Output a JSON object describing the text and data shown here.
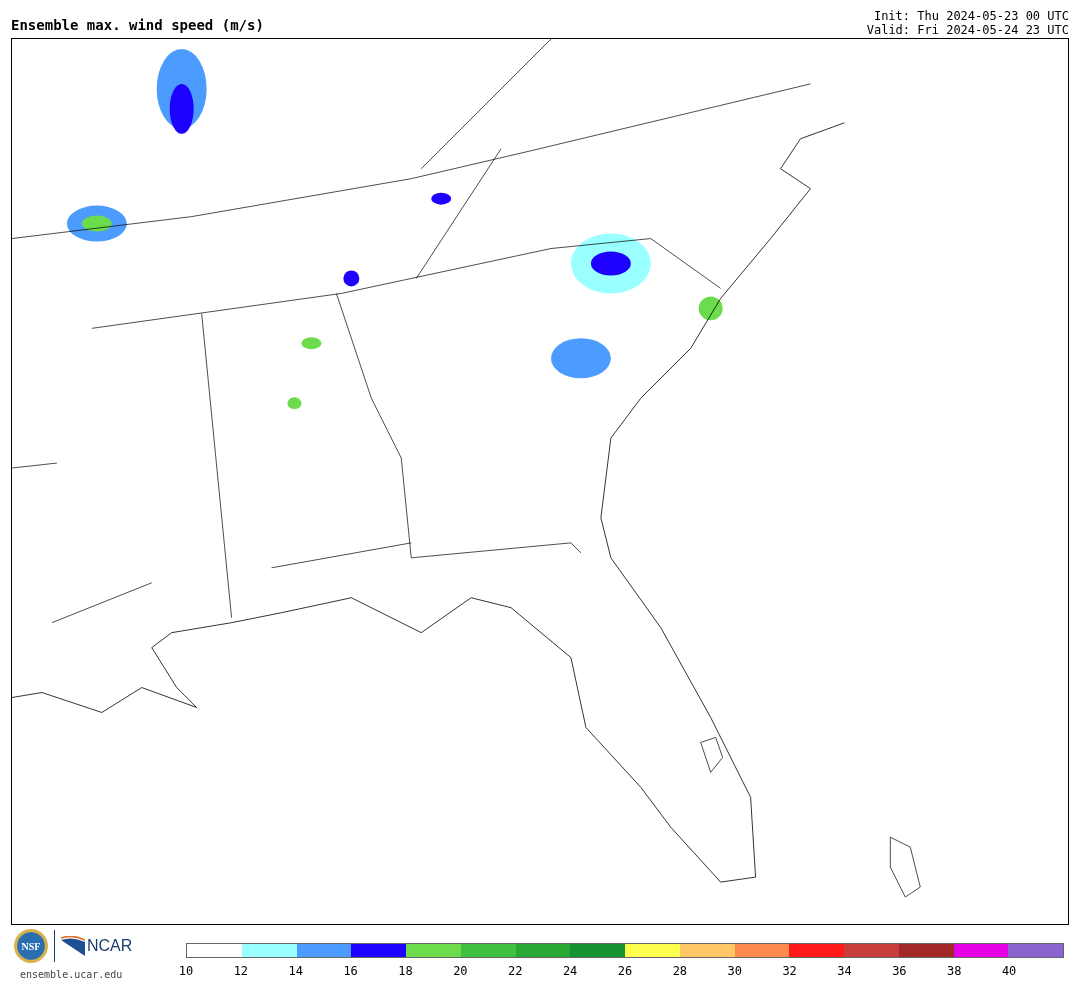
{
  "title": "Ensemble max. wind speed (m/s)",
  "init": "Init: Thu 2024-05-23 00 UTC",
  "valid": "Valid: Fri 2024-05-24 23 UTC",
  "logos": {
    "nsf": "NSF",
    "ncar": "NCAR",
    "url": "ensemble.ucar.edu"
  },
  "colorbar": {
    "bins": [
      {
        "color": "#ffffff"
      },
      {
        "color": "#99ffff"
      },
      {
        "color": "#4c9cff"
      },
      {
        "color": "#1e00ff"
      },
      {
        "color": "#6cdc4c"
      },
      {
        "color": "#40c040"
      },
      {
        "color": "#28a834"
      },
      {
        "color": "#169434"
      },
      {
        "color": "#ffff50"
      },
      {
        "color": "#ffc864"
      },
      {
        "color": "#ff8a50"
      },
      {
        "color": "#ff1a1a"
      },
      {
        "color": "#c83c3c"
      },
      {
        "color": "#a02828"
      },
      {
        "color": "#e600e6"
      },
      {
        "color": "#8c64d2"
      }
    ],
    "ticks": [
      "10",
      "12",
      "14",
      "16",
      "18",
      "20",
      "22",
      "24",
      "26",
      "28",
      "30",
      "32",
      "34",
      "36",
      "38",
      "40"
    ]
  }
}
